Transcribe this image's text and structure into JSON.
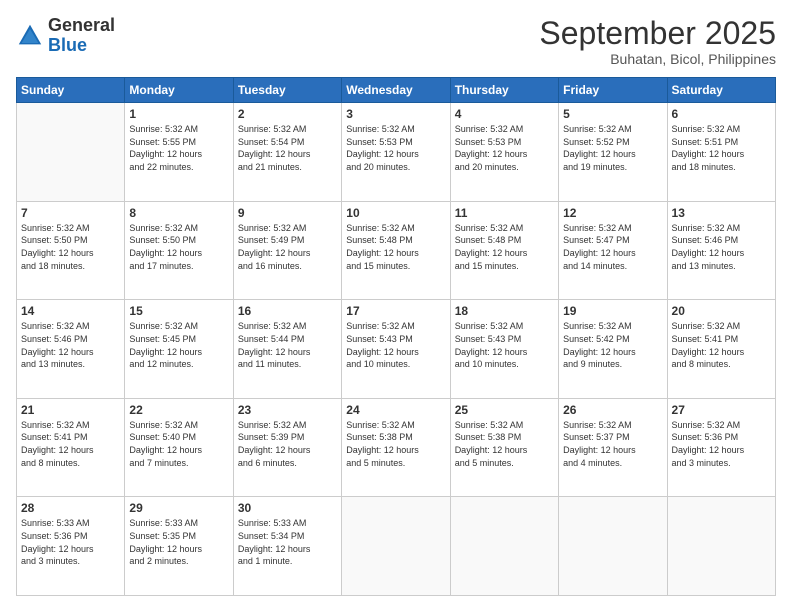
{
  "logo": {
    "general": "General",
    "blue": "Blue"
  },
  "header": {
    "title": "September 2025",
    "location": "Buhatan, Bicol, Philippines"
  },
  "weekdays": [
    "Sunday",
    "Monday",
    "Tuesday",
    "Wednesday",
    "Thursday",
    "Friday",
    "Saturday"
  ],
  "weeks": [
    [
      {
        "day": "",
        "info": ""
      },
      {
        "day": "1",
        "info": "Sunrise: 5:32 AM\nSunset: 5:55 PM\nDaylight: 12 hours\nand 22 minutes."
      },
      {
        "day": "2",
        "info": "Sunrise: 5:32 AM\nSunset: 5:54 PM\nDaylight: 12 hours\nand 21 minutes."
      },
      {
        "day": "3",
        "info": "Sunrise: 5:32 AM\nSunset: 5:53 PM\nDaylight: 12 hours\nand 20 minutes."
      },
      {
        "day": "4",
        "info": "Sunrise: 5:32 AM\nSunset: 5:53 PM\nDaylight: 12 hours\nand 20 minutes."
      },
      {
        "day": "5",
        "info": "Sunrise: 5:32 AM\nSunset: 5:52 PM\nDaylight: 12 hours\nand 19 minutes."
      },
      {
        "day": "6",
        "info": "Sunrise: 5:32 AM\nSunset: 5:51 PM\nDaylight: 12 hours\nand 18 minutes."
      }
    ],
    [
      {
        "day": "7",
        "info": "Sunrise: 5:32 AM\nSunset: 5:50 PM\nDaylight: 12 hours\nand 18 minutes."
      },
      {
        "day": "8",
        "info": "Sunrise: 5:32 AM\nSunset: 5:50 PM\nDaylight: 12 hours\nand 17 minutes."
      },
      {
        "day": "9",
        "info": "Sunrise: 5:32 AM\nSunset: 5:49 PM\nDaylight: 12 hours\nand 16 minutes."
      },
      {
        "day": "10",
        "info": "Sunrise: 5:32 AM\nSunset: 5:48 PM\nDaylight: 12 hours\nand 15 minutes."
      },
      {
        "day": "11",
        "info": "Sunrise: 5:32 AM\nSunset: 5:48 PM\nDaylight: 12 hours\nand 15 minutes."
      },
      {
        "day": "12",
        "info": "Sunrise: 5:32 AM\nSunset: 5:47 PM\nDaylight: 12 hours\nand 14 minutes."
      },
      {
        "day": "13",
        "info": "Sunrise: 5:32 AM\nSunset: 5:46 PM\nDaylight: 12 hours\nand 13 minutes."
      }
    ],
    [
      {
        "day": "14",
        "info": "Sunrise: 5:32 AM\nSunset: 5:46 PM\nDaylight: 12 hours\nand 13 minutes."
      },
      {
        "day": "15",
        "info": "Sunrise: 5:32 AM\nSunset: 5:45 PM\nDaylight: 12 hours\nand 12 minutes."
      },
      {
        "day": "16",
        "info": "Sunrise: 5:32 AM\nSunset: 5:44 PM\nDaylight: 12 hours\nand 11 minutes."
      },
      {
        "day": "17",
        "info": "Sunrise: 5:32 AM\nSunset: 5:43 PM\nDaylight: 12 hours\nand 10 minutes."
      },
      {
        "day": "18",
        "info": "Sunrise: 5:32 AM\nSunset: 5:43 PM\nDaylight: 12 hours\nand 10 minutes."
      },
      {
        "day": "19",
        "info": "Sunrise: 5:32 AM\nSunset: 5:42 PM\nDaylight: 12 hours\nand 9 minutes."
      },
      {
        "day": "20",
        "info": "Sunrise: 5:32 AM\nSunset: 5:41 PM\nDaylight: 12 hours\nand 8 minutes."
      }
    ],
    [
      {
        "day": "21",
        "info": "Sunrise: 5:32 AM\nSunset: 5:41 PM\nDaylight: 12 hours\nand 8 minutes."
      },
      {
        "day": "22",
        "info": "Sunrise: 5:32 AM\nSunset: 5:40 PM\nDaylight: 12 hours\nand 7 minutes."
      },
      {
        "day": "23",
        "info": "Sunrise: 5:32 AM\nSunset: 5:39 PM\nDaylight: 12 hours\nand 6 minutes."
      },
      {
        "day": "24",
        "info": "Sunrise: 5:32 AM\nSunset: 5:38 PM\nDaylight: 12 hours\nand 5 minutes."
      },
      {
        "day": "25",
        "info": "Sunrise: 5:32 AM\nSunset: 5:38 PM\nDaylight: 12 hours\nand 5 minutes."
      },
      {
        "day": "26",
        "info": "Sunrise: 5:32 AM\nSunset: 5:37 PM\nDaylight: 12 hours\nand 4 minutes."
      },
      {
        "day": "27",
        "info": "Sunrise: 5:32 AM\nSunset: 5:36 PM\nDaylight: 12 hours\nand 3 minutes."
      }
    ],
    [
      {
        "day": "28",
        "info": "Sunrise: 5:33 AM\nSunset: 5:36 PM\nDaylight: 12 hours\nand 3 minutes."
      },
      {
        "day": "29",
        "info": "Sunrise: 5:33 AM\nSunset: 5:35 PM\nDaylight: 12 hours\nand 2 minutes."
      },
      {
        "day": "30",
        "info": "Sunrise: 5:33 AM\nSunset: 5:34 PM\nDaylight: 12 hours\nand 1 minute."
      },
      {
        "day": "",
        "info": ""
      },
      {
        "day": "",
        "info": ""
      },
      {
        "day": "",
        "info": ""
      },
      {
        "day": "",
        "info": ""
      }
    ]
  ]
}
